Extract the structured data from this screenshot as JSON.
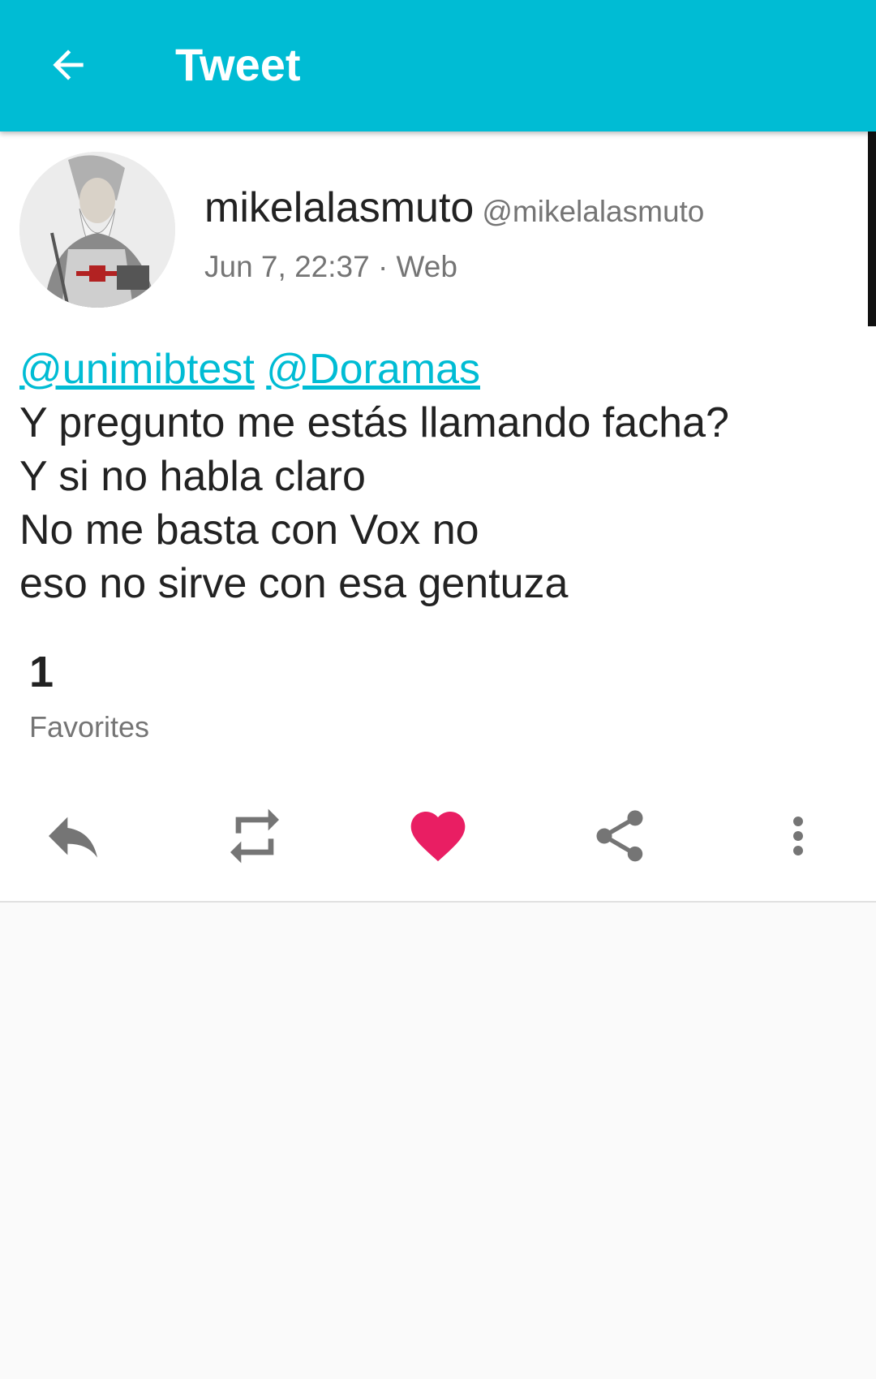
{
  "appbar": {
    "title": "Tweet",
    "back_icon": "arrow-back-icon",
    "background": "#00bcd4"
  },
  "tweet": {
    "display_name": "mikelalasmuto",
    "screen_name": "@mikelalasmuto",
    "meta": "Jun 7, 22:37 · Web",
    "mentions": [
      "@unimibtest",
      "@Doramas"
    ],
    "lines": [
      "Y pregunto me estás llamando facha?",
      "Y si no habla claro",
      "No me basta con Vox no",
      "eso no sirve con esa gentuza"
    ],
    "favorites_count": "1",
    "favorites_label": "Favorites"
  },
  "actions": [
    {
      "icon": "reply-icon"
    },
    {
      "icon": "retweet-icon"
    },
    {
      "icon": "heart-icon",
      "color": "#e91e63"
    },
    {
      "icon": "share-icon"
    },
    {
      "icon": "more-vert-icon"
    }
  ],
  "colors": {
    "accent": "#00bcd4",
    "like": "#e91e63",
    "icon_gray": "#757575"
  }
}
